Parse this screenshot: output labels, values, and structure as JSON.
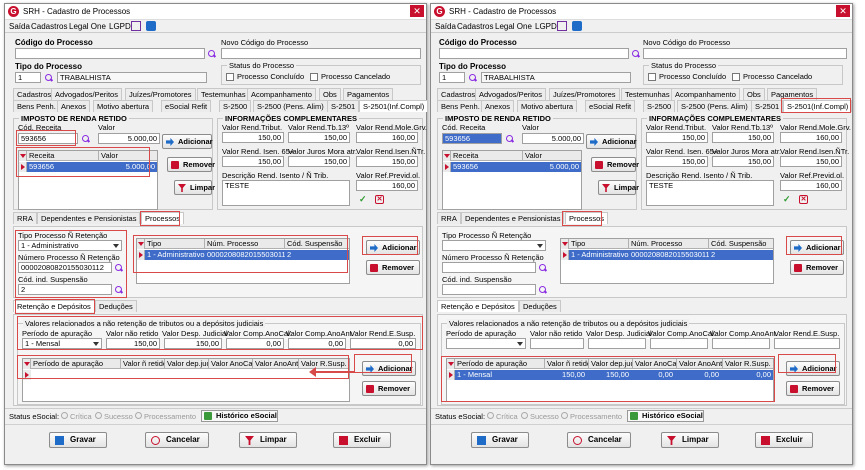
{
  "window": {
    "title": "SRH - Cadastro de Processos",
    "close": "✕"
  },
  "menu": {
    "saida": "Saída",
    "cadastros": "Cadastros",
    "legal_one": "Legal One",
    "lgpd": "LGPD"
  },
  "header": {
    "codigo_label": "Código do Processo",
    "novo_codigo_label": "Novo Código do Processo",
    "tipo_label": "Tipo do Processo",
    "tipo_code": "1",
    "tipo_name": "TRABALHISTA",
    "status_label": "Status do Processo",
    "concluido": "Processo Concluído",
    "cancelado": "Processo Cancelado"
  },
  "main_tabs_top": [
    "Cadastros",
    "Advogados/Peritos",
    "Juízes/Promotores",
    "Testemunhas",
    "Acompanhamento",
    "Obs",
    "Pagamentos"
  ],
  "main_tabs_bottom": [
    "Bens Penh.",
    "Anexos",
    "Motivo abertura",
    "eSocial Refit",
    "S-2500",
    "S-2500 (Pens. Alim)",
    "S-2501",
    "S-2501(Inf.Compl)"
  ],
  "irrf": {
    "title": "IMPOSTO DE RENDA RETIDO",
    "cod_receita_label": "Cód. Receita",
    "valor_label": "Valor",
    "cod_receita": "593656",
    "valor": "5.000,00",
    "grid_headers": [
      "Receita",
      "Valor"
    ],
    "row": {
      "receita": "593656",
      "valor": "5.000,00"
    },
    "adicionar": "Adicionar",
    "remover": "Remover",
    "limpar": "Limpar"
  },
  "info": {
    "title": "INFORMAÇÕES COMPLEMENTARES",
    "l1": "Valor Rend.Tribut.",
    "l2": "Valor Rend.Tb.13º",
    "l3": "Valor Rend.Mole.Grv.",
    "v1": "150,00",
    "v2": "150,00",
    "v3": "160,00",
    "l4": "Valor Rend. Isen. 65+",
    "l5": "Valor Juros Mora atr.",
    "l6": "Valor Rend.Isen.ÑTr.",
    "v4": "150,00",
    "v5": "150,00",
    "v6": "150,00",
    "l7": "Descrição Rend. Isento / Ñ Trib.",
    "l8": "Valor Ref.Previd.ol.",
    "desc": "TESTE",
    "v8": "160,00"
  },
  "sub_tabs": [
    "RRA",
    "Dependentes e Pensionistas",
    "Processos"
  ],
  "processos": {
    "tipo_label": "Tipo Processo Ñ Retenção",
    "tipo_value": "1 - Administrativo",
    "numero_label": "Número Processo Ñ Retenção",
    "numero_value": "00002080820155030112",
    "susp_label": "Cód. ind. Suspensão",
    "susp_value": "2",
    "grid_headers": [
      "Tipo",
      "Núm. Processo",
      "Cód. Suspensão"
    ],
    "row": {
      "tipo": "1 - Administrativo",
      "num": "00002080820155030112",
      "cod": "2"
    },
    "adicionar": "Adicionar",
    "remover": "Remover"
  },
  "ret_tabs": [
    "Retenção e Depósitos",
    "Deduções"
  ],
  "retencao": {
    "group_title": "Valores relacionados a não retenção de tributos ou a depósitos judiciais",
    "periodo_label": "Período de apuração",
    "valor_nao_retido_label": "Valor não retido",
    "valor_desp_label": "Valor Desp. Judicial",
    "valor_comp_cal_label": "Valor Comp.AnoCal.",
    "valor_comp_ant_label": "Valor Comp.AnoAnt.",
    "valor_rend_susp_label": "Valor Rend.E.Susp.",
    "periodo_value": "1 - Mensal",
    "valor_nao_retido": "150,00",
    "valor_desp": "150,00",
    "valor_comp_cal": "0,00",
    "valor_comp_ant": "0,00",
    "valor_rend_susp": "0,00",
    "grid_headers_left": [
      "Período de apuração",
      "Valor ñ retido",
      "Valor dep.jud.",
      "Valor AnoCal.",
      "Valor AnoAnt.",
      "Valor R.Susp."
    ],
    "grid_headers_right": [
      "Período de apuração",
      "Valor ñ retido",
      "Valor dep.jud.",
      "Valor AnoCal.",
      "Valor AnoAnt.",
      "Valor R.Susp."
    ],
    "row": {
      "periodo": "1 - Mensal",
      "v1": "150,00",
      "v2": "150,00",
      "v3": "0,00",
      "v4": "0,00",
      "v5": "0,00"
    },
    "adicionar": "Adicionar",
    "remover": "Remover"
  },
  "status": {
    "label": "Status eSocial:",
    "critica": "Crítica",
    "sucesso": "Sucesso",
    "processamento": "Processamento",
    "historico": "Histórico eSocial"
  },
  "footer": {
    "gravar": "Gravar",
    "cancelar": "Cancelar",
    "limpar": "Limpar",
    "excluir": "Excluir"
  }
}
